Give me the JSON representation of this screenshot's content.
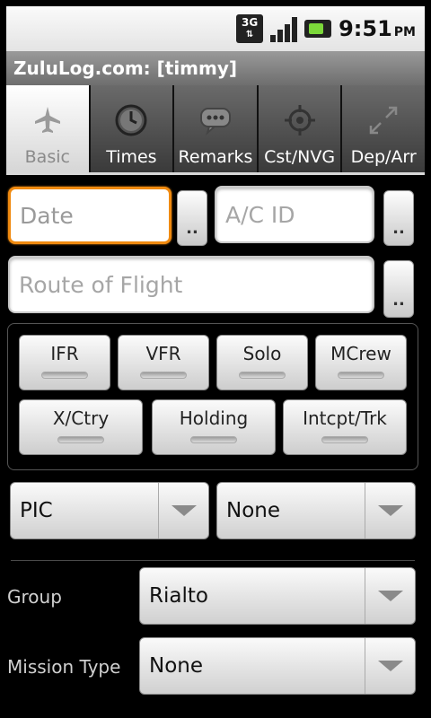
{
  "status_bar": {
    "network": "3G",
    "time": "9:51",
    "ampm": "PM"
  },
  "title": "ZuluLog.com: [timmy]",
  "tabs": [
    {
      "label": "Basic",
      "icon": "airplane-icon",
      "active": true
    },
    {
      "label": "Times",
      "icon": "clock-icon",
      "active": false
    },
    {
      "label": "Remarks",
      "icon": "speech-bubble-icon",
      "active": false
    },
    {
      "label": "Cst/NVG",
      "icon": "crosshair-icon",
      "active": false
    },
    {
      "label": "Dep/Arr",
      "icon": "arrows-diagonal-icon",
      "active": false
    }
  ],
  "form": {
    "date_placeholder": "Date",
    "acid_placeholder": "A/C ID",
    "route_placeholder": "Route of Flight",
    "picker_label": ".."
  },
  "flags": {
    "row1": [
      "IFR",
      "VFR",
      "Solo",
      "MCrew"
    ],
    "row2": [
      "X/Ctry",
      "Holding",
      "Intcpt/Trk"
    ]
  },
  "role_select": {
    "value": "PIC"
  },
  "second_select": {
    "value": "None"
  },
  "group": {
    "label": "Group",
    "value": "Rialto"
  },
  "mission_type": {
    "label": "Mission Type",
    "value": "None"
  }
}
